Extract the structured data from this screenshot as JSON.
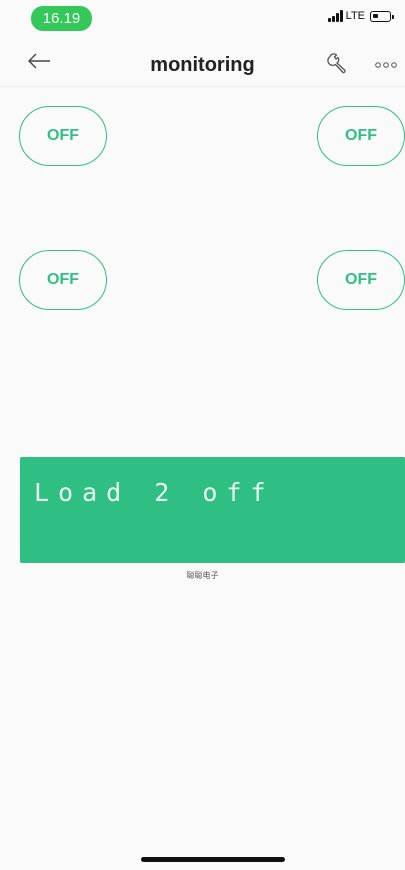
{
  "status_bar": {
    "time": "16.19",
    "network": "LTE"
  },
  "nav": {
    "title": "monitoring"
  },
  "buttons": [
    {
      "label": "OFF"
    },
    {
      "label": "OFF"
    },
    {
      "label": "OFF"
    },
    {
      "label": "OFF"
    }
  ],
  "lcd": {
    "text": "Load 2 off",
    "caption": "聪聪电子"
  },
  "colors": {
    "accent": "#2ec183",
    "lcd_background": "#2fbf82",
    "status_time_pill": "#34c759"
  },
  "icons": [
    "back-arrow-icon",
    "wrench-icon",
    "more-dots-icon",
    "signal-icon",
    "battery-icon"
  ]
}
